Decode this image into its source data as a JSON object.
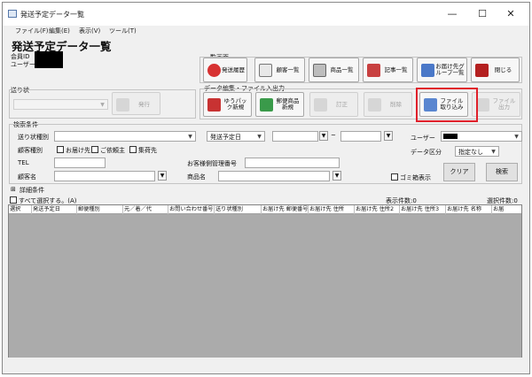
{
  "window": {
    "title": "発送予定データ一覧",
    "minimize": "—",
    "maximize": "☐",
    "close": "✕"
  },
  "menu": [
    "ファイル(F)",
    "編集(E)",
    "表示(V)",
    "ツール(T)"
  ],
  "page_title": "発送予定データ一覧",
  "info": {
    "member_id_label": "会員ID",
    "user_label": "ユーザー"
  },
  "sections": {
    "list_screen": "一覧画面",
    "data_edit": "データ編集・ファイル入出力",
    "invoice": "送り状"
  },
  "toolbar": {
    "history": "発送履歴",
    "customers": "顧客一覧",
    "products": "商品一覧",
    "articles": "記事一覧",
    "delivery_group": "お届け先グループ一覧",
    "close": "閉じる",
    "yupack_new": "ゆうパック新規",
    "postal_new": "郵便商品新規",
    "correct": "訂正",
    "delete": "削除",
    "file_import": "ファイル取り込み",
    "file_output": "ファイル出力",
    "issue": "発行"
  },
  "search": {
    "heading": "検索条件",
    "invoice_type": "送り状種別",
    "date_type": "発送予定日",
    "tilde": "~",
    "user": "ユーザー",
    "customer_type": "顧客種別",
    "opt_delivery": "お届け先",
    "opt_requester": "ご依頼主",
    "opt_collection": "集荷先",
    "data_division": "データ区分",
    "data_division_value": "指定なし",
    "tel": "TEL",
    "mgmt_no": "お客様側管理番号",
    "customer_name": "顧客名",
    "product_name": "商品名",
    "gobako": "ゴミ箱表示",
    "clear": "クリア",
    "search": "検索"
  },
  "details": {
    "toggle": "⊞",
    "label": "詳細条件"
  },
  "select_all": "すべて選択する。(A)",
  "display_count": "表示件数:0",
  "selected_count": "選択件数:0",
  "columns": [
    "選択",
    "発送予定日",
    "郵便種別",
    "元／着／代",
    "お問い合わせ番号",
    "送り状種別",
    "お届け先 郵便番号",
    "お届け先 住所",
    "お届け先 住所2",
    "お届け先 住所3",
    "お届け先 名称",
    "お届"
  ]
}
